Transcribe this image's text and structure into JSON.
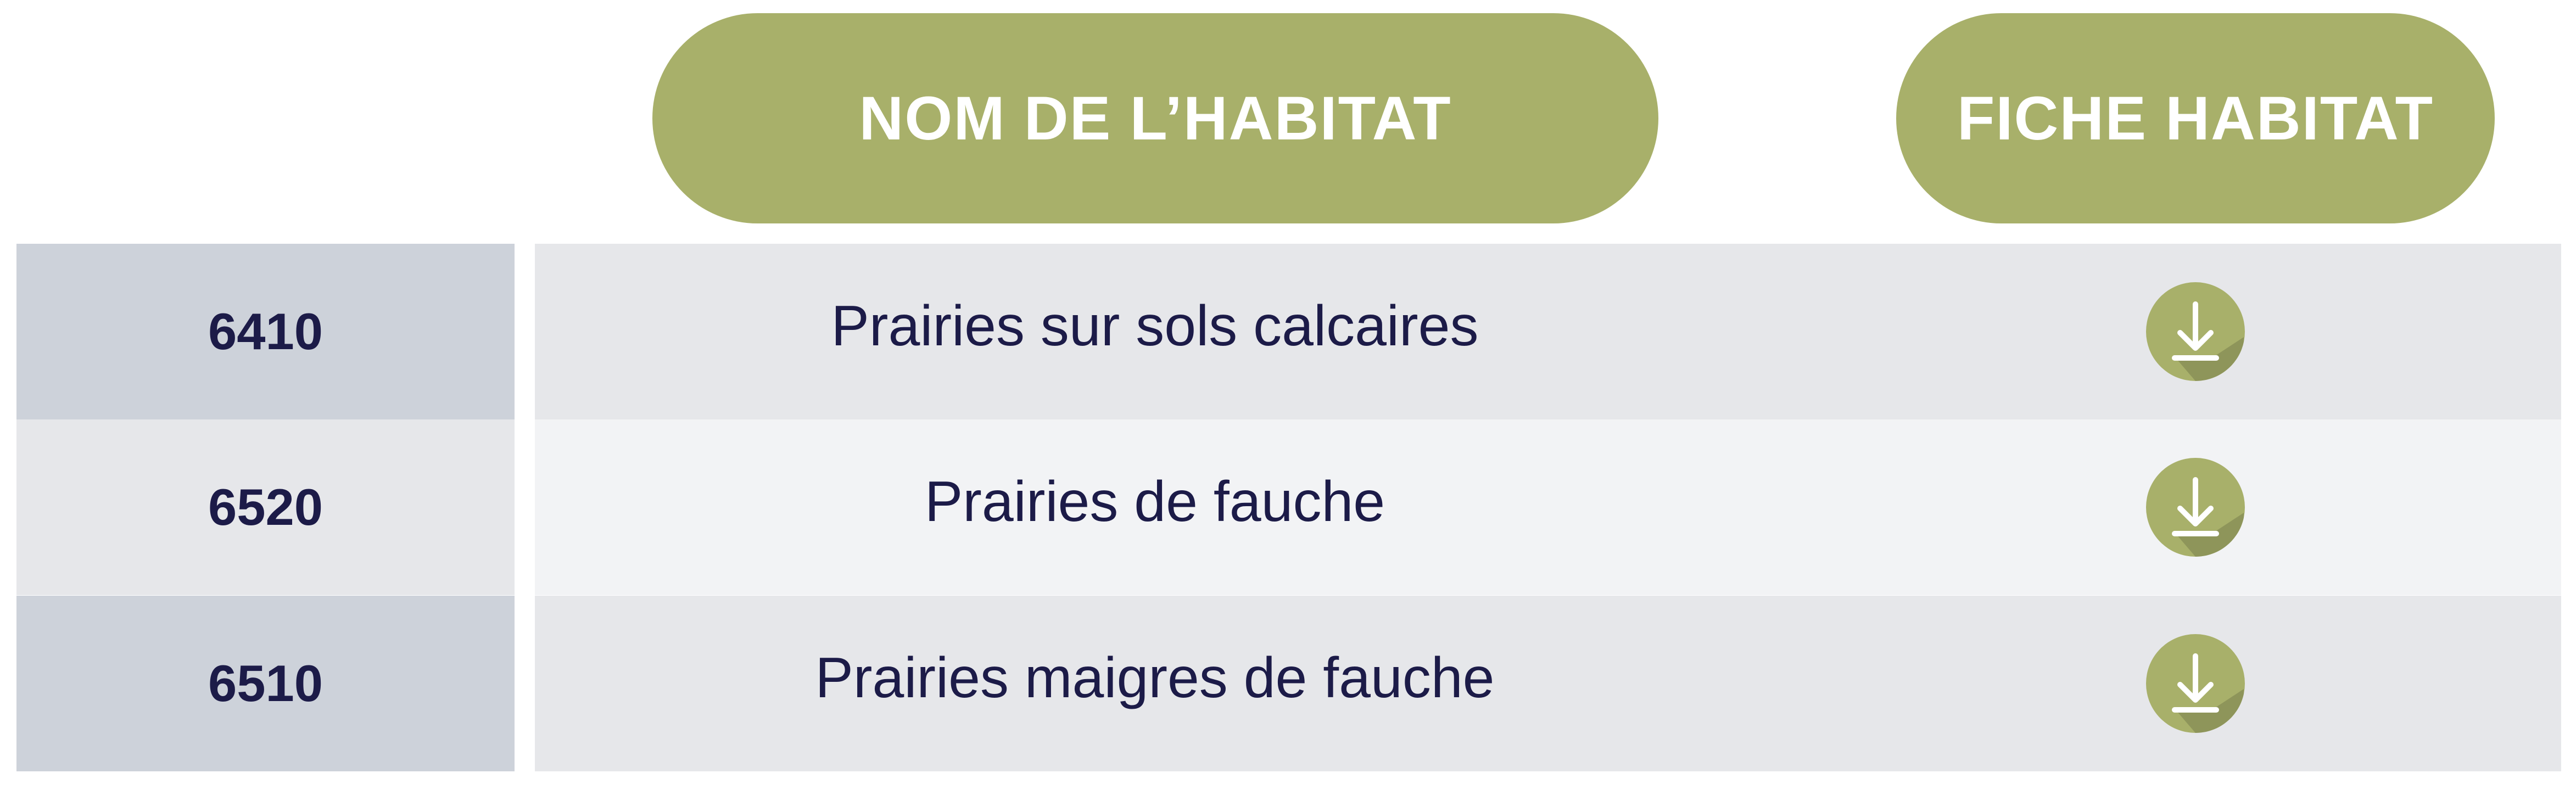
{
  "header": {
    "name_label": "NOM DE L’HABITAT",
    "fiche_label": "FICHE HABITAT"
  },
  "rows": [
    {
      "code": "6410",
      "name": "Prairies sur sols calcaires",
      "action_icon": "download-icon"
    },
    {
      "code": "6520",
      "name": "Prairies de fauche",
      "action_icon": "download-icon"
    },
    {
      "code": "6510",
      "name": "Prairies maigres de fauche",
      "action_icon": "download-icon"
    }
  ],
  "colors": {
    "accent": "#a8b06a",
    "accent_shadow": "#8e955a",
    "text": "#1c1b48",
    "code_bg": "#cdd2da",
    "row_bg": "#e6e7ea",
    "row_alt_bg": "#f2f3f5"
  }
}
